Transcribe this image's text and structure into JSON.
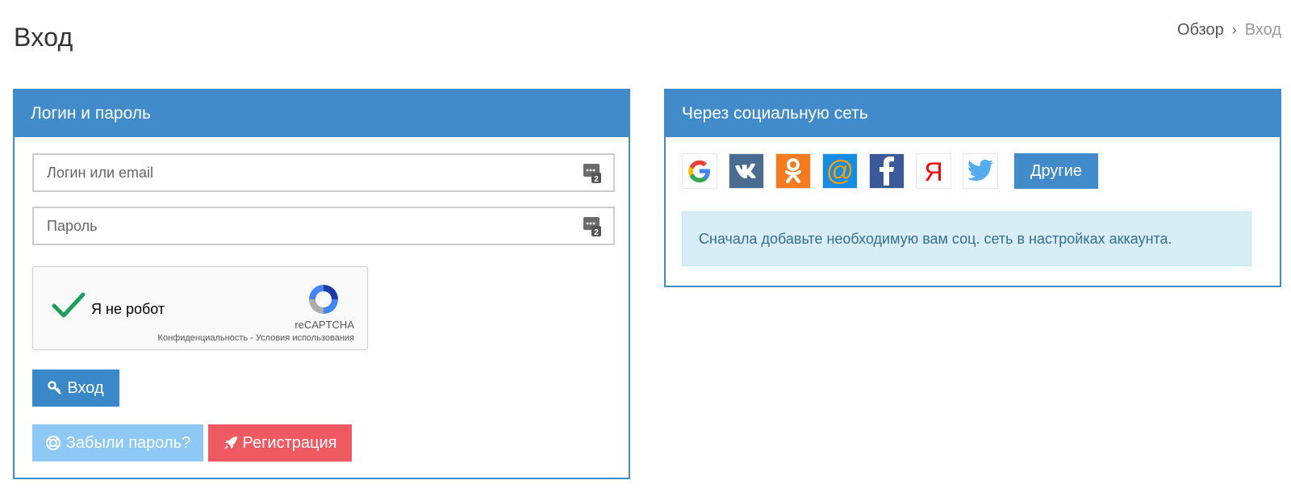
{
  "page": {
    "title": "Вход"
  },
  "breadcrumb": {
    "items": [
      "Обзор",
      "Вход"
    ],
    "separator": "›"
  },
  "login_panel": {
    "title": "Логин и пароль",
    "login_placeholder": "Логин или email",
    "password_placeholder": "Пароль",
    "captcha": {
      "label": "Я не робот",
      "brand": "reCAPTCHA",
      "links": "Конфиденциальность - Условия использования",
      "checked": true
    },
    "login_button": "Вход",
    "forgot_button": "Забыли пароль?",
    "register_button": "Регистрация"
  },
  "social_panel": {
    "title": "Через социальную сеть",
    "providers": [
      "google-icon",
      "vk-icon",
      "odnoklassniki-icon",
      "mailru-icon",
      "facebook-icon",
      "yandex-icon",
      "twitter-icon"
    ],
    "other_button": "Другие",
    "notice": "Сначала добавьте необходимую вам соц. сеть в настройках аккаунта."
  },
  "colors": {
    "primary": "#428bca",
    "forgot": "#8ec8f4",
    "register": "#ef5a62",
    "alert_bg": "#d9edf7",
    "alert_text": "#31708f"
  }
}
